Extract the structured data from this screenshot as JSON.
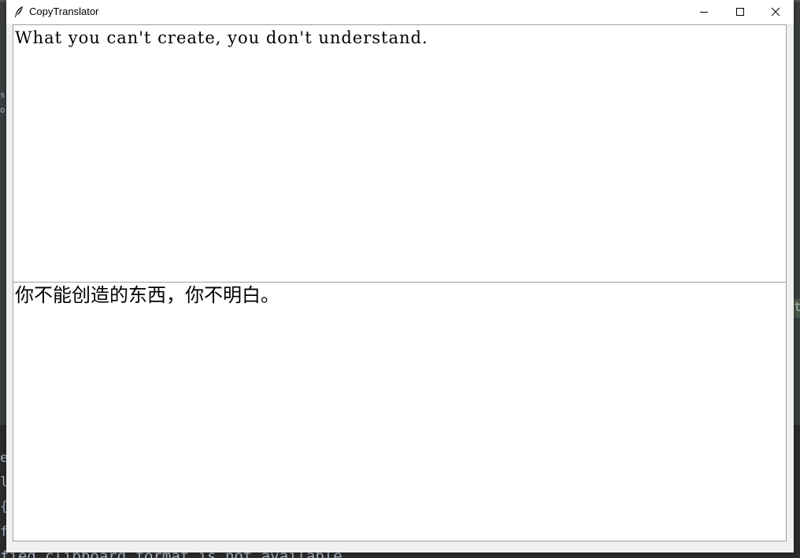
{
  "window": {
    "title": "CopyTranslator",
    "icon": "quill-feather-icon",
    "controls": {
      "minimize": "minimize-icon",
      "maximize": "maximize-icon",
      "close": "close-icon"
    }
  },
  "source_pane": {
    "text": "What you can't create, you don't understand."
  },
  "target_pane": {
    "text": "你不能创造的东西，你不明白。"
  },
  "background": {
    "console_line": "fied clipboard format is not available",
    "edge_glyphs": [
      "e",
      "l",
      "{",
      "f"
    ],
    "small_glyphs": [
      "s",
      "o"
    ],
    "right_mark": "t"
  }
}
